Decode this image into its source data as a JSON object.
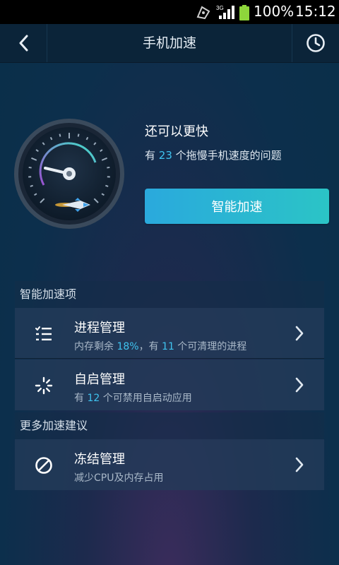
{
  "status_bar": {
    "network": "3G",
    "battery_percent": "100%",
    "time": "15:12"
  },
  "header": {
    "title": "手机加速"
  },
  "hero": {
    "heading": "还可以更快",
    "issue_prefix": "有 ",
    "issue_count": "23",
    "issue_suffix": " 个拖慢手机速度的问题",
    "boost_button": "智能加速"
  },
  "sections": [
    {
      "title": "智能加速项",
      "items": [
        {
          "icon": "list-icon",
          "title": "进程管理",
          "sub_parts": [
            "内存剩余 ",
            "18%",
            "，有 ",
            "11",
            " 个可清理的进程"
          ]
        },
        {
          "icon": "spinner-icon",
          "title": "自启管理",
          "sub_parts": [
            "有 ",
            "12",
            " 个可禁用自启动应用"
          ]
        }
      ]
    },
    {
      "title": "更多加速建议",
      "items": [
        {
          "icon": "ban-icon",
          "title": "冻结管理",
          "sub": "减少CPU及内存占用"
        }
      ]
    }
  ],
  "colors": {
    "accent": "#3fc3ef",
    "button_start": "#2aa9dd",
    "button_end": "#2bc4c6",
    "battery": "#8ed63b"
  }
}
